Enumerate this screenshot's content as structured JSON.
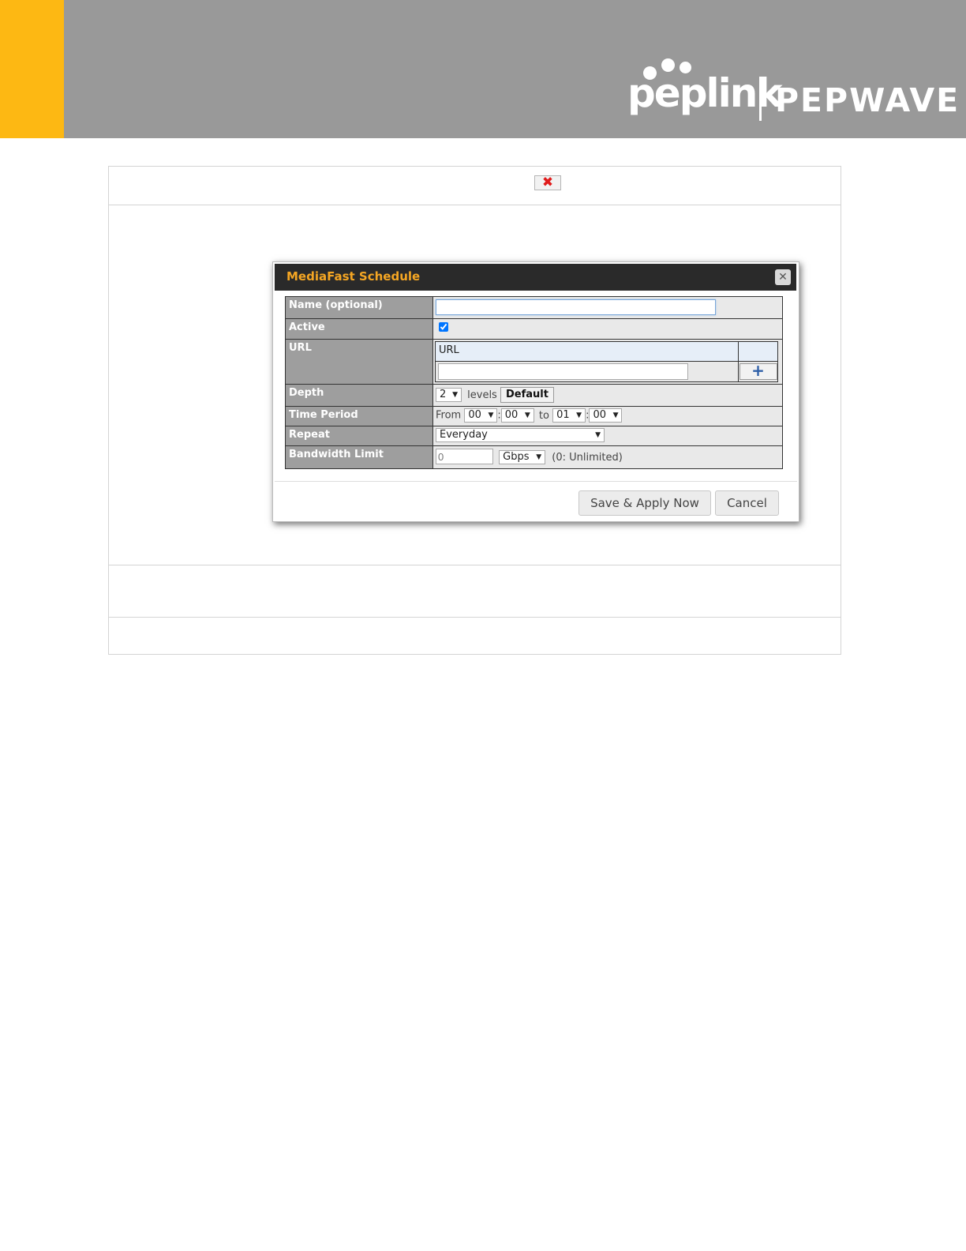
{
  "brand": {
    "logo_primary": "peplink",
    "logo_secondary": "PEPWAVE",
    "accent_color": "#fdb813",
    "banner_color": "#999999"
  },
  "frame": {
    "close_icon": "close-x-icon"
  },
  "modal": {
    "title": "MediaFast Schedule",
    "close_icon": "close-icon",
    "fields": {
      "name": {
        "label": "Name (optional)",
        "value": ""
      },
      "active": {
        "label": "Active",
        "checked": true
      },
      "url": {
        "label": "URL",
        "column_header": "URL",
        "value": "",
        "add_icon": "plus-icon"
      },
      "depth": {
        "label": "Depth",
        "value": "2",
        "unit": "levels",
        "default_button": "Default"
      },
      "time_period": {
        "label": "Time Period",
        "from_label": "From",
        "from_hour": "00",
        "from_minute": "00",
        "to_label": "to",
        "to_hour": "01",
        "to_minute": "00",
        "separator": ":"
      },
      "repeat": {
        "label": "Repeat",
        "value": "Everyday"
      },
      "bandwidth": {
        "label": "Bandwidth Limit",
        "placeholder": "0",
        "unit": "Gbps",
        "hint": "(0: Unlimited)"
      }
    },
    "buttons": {
      "save": "Save & Apply Now",
      "cancel": "Cancel"
    }
  }
}
